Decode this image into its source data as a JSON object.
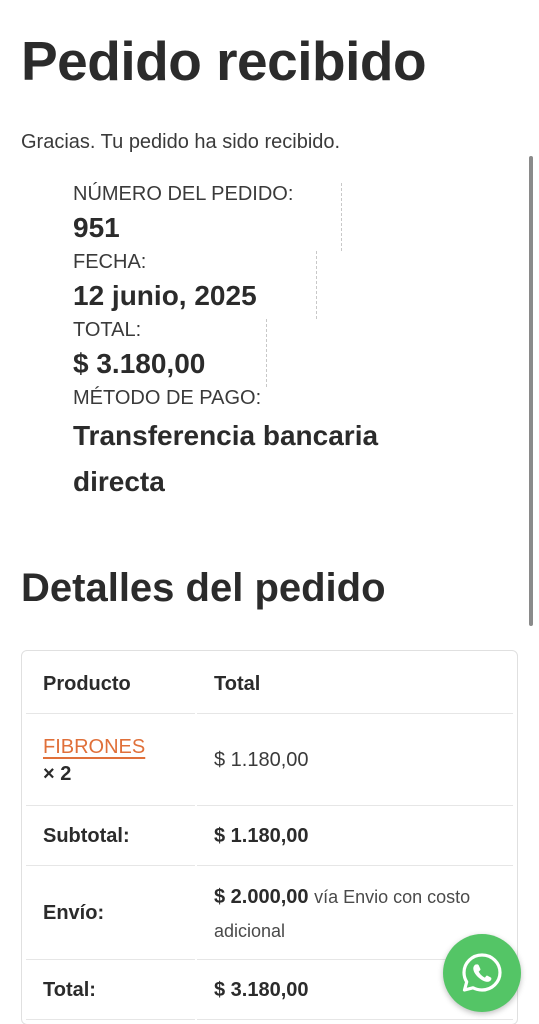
{
  "page": {
    "title": "Pedido recibido",
    "thanks": "Gracias. Tu pedido ha sido recibido."
  },
  "overview": {
    "order_number_label": "NÚMERO DEL PEDIDO:",
    "order_number": "951",
    "date_label": "FECHA:",
    "date": "12 junio, 2025",
    "total_label": "TOTAL:",
    "total": "$ 3.180,00",
    "payment_label": "MÉTODO DE PAGO:",
    "payment": "Transferencia bancaria directa"
  },
  "details": {
    "title": "Detalles del pedido",
    "headers": {
      "product": "Producto",
      "total": "Total"
    },
    "item": {
      "name": "FIBRONES",
      "qty": "× 2",
      "total": "$ 1.180,00"
    },
    "subtotal": {
      "label": "Subtotal:",
      "value": "$ 1.180,00"
    },
    "shipping": {
      "label": "Envío:",
      "value": "$ 2.000,00",
      "via": "vía Envio con costo adicional"
    },
    "total": {
      "label": "Total:",
      "value": "$ 3.180,00"
    }
  },
  "floating": {
    "icon": "whatsapp-icon",
    "color": "#54c566"
  }
}
